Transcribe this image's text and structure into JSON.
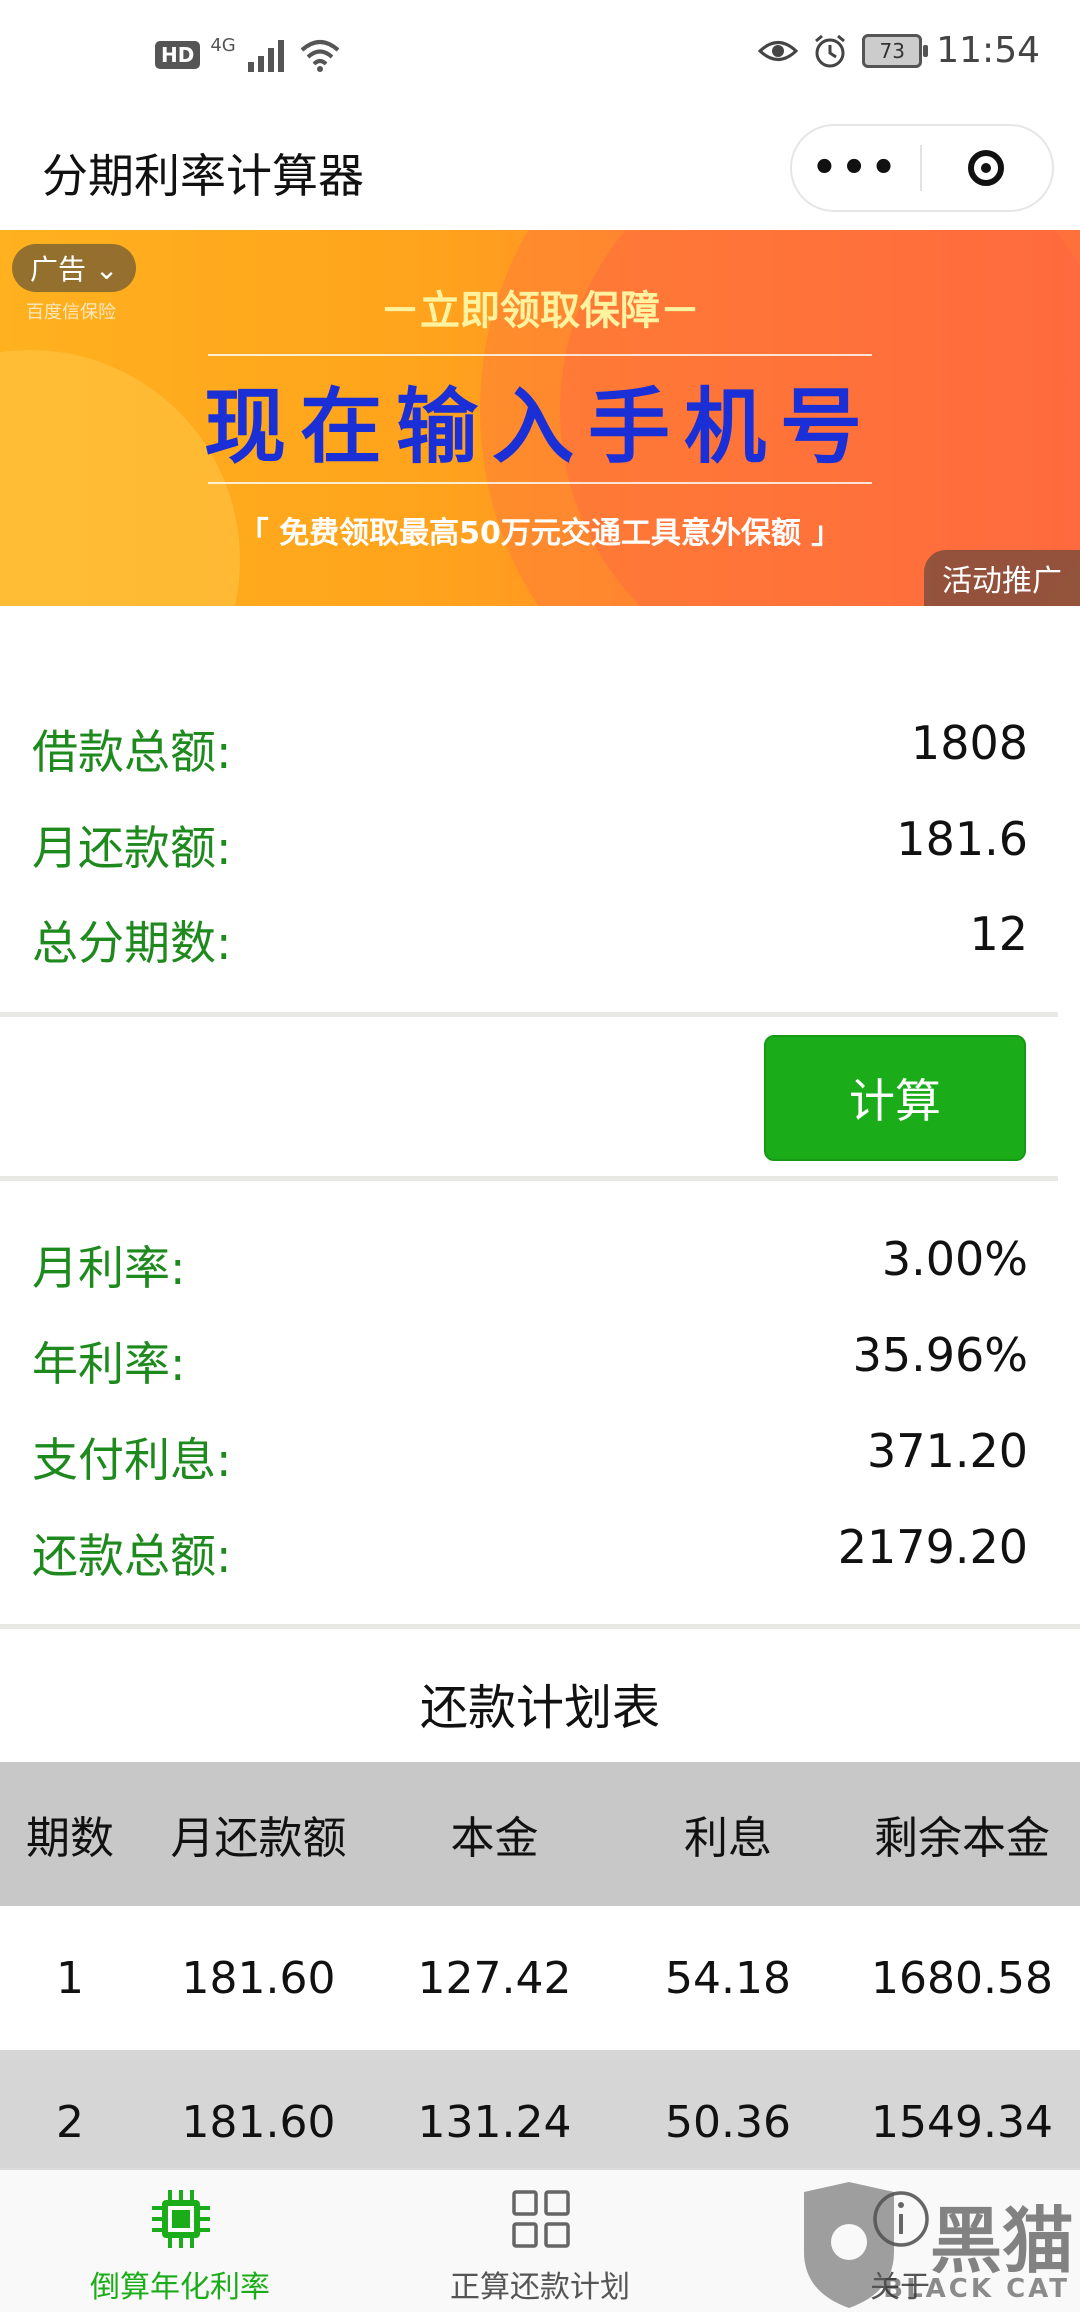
{
  "status_bar": {
    "hd": "HD",
    "network": "4G",
    "battery": "73",
    "time": "11:54"
  },
  "title_bar": {
    "title": "分期利率计算器",
    "more_label": "•••"
  },
  "ad": {
    "tag": "广告",
    "logo": "百度信保险",
    "line1": "－立即领取保障－",
    "line2": "现在输入手机号",
    "line3": "「 免费领取最高50万元交通工具意外保额 」",
    "corner_label": "活动推广"
  },
  "inputs": [
    {
      "label": "借款总额:",
      "value": "1808"
    },
    {
      "label": "月还款额:",
      "value": "181.6"
    },
    {
      "label": "总分期数:",
      "value": "12"
    }
  ],
  "calculate_label": "计算",
  "results": [
    {
      "label": "月利率:",
      "value": "3.00%"
    },
    {
      "label": "年利率:",
      "value": "35.96%"
    },
    {
      "label": "支付利息:",
      "value": "371.20"
    },
    {
      "label": "还款总额:",
      "value": "2179.20"
    }
  ],
  "schedule": {
    "title": "还款计划表",
    "headers": [
      "期数",
      "月还款额",
      "本金",
      "利息",
      "剩余本金"
    ],
    "rows": [
      [
        "1",
        "181.60",
        "127.42",
        "54.18",
        "1680.58"
      ],
      [
        "2",
        "181.60",
        "131.24",
        "50.36",
        "1549.34"
      ]
    ]
  },
  "tab_bar": {
    "tabs": [
      {
        "label": "倒算年化利率",
        "icon": "chip-icon",
        "active": true
      },
      {
        "label": "正算还款计划",
        "icon": "grid-icon",
        "active": false
      },
      {
        "label": "关于",
        "icon": "info-icon",
        "active": false
      }
    ]
  },
  "watermark": {
    "text": "黑猫",
    "sub": "BLACK CAT"
  },
  "colors": {
    "accent_green": "#1aad19",
    "label_green": "#1e8a1e",
    "ad_orange": "#ffa31c",
    "ad_blue_text": "#1a2fd6"
  }
}
